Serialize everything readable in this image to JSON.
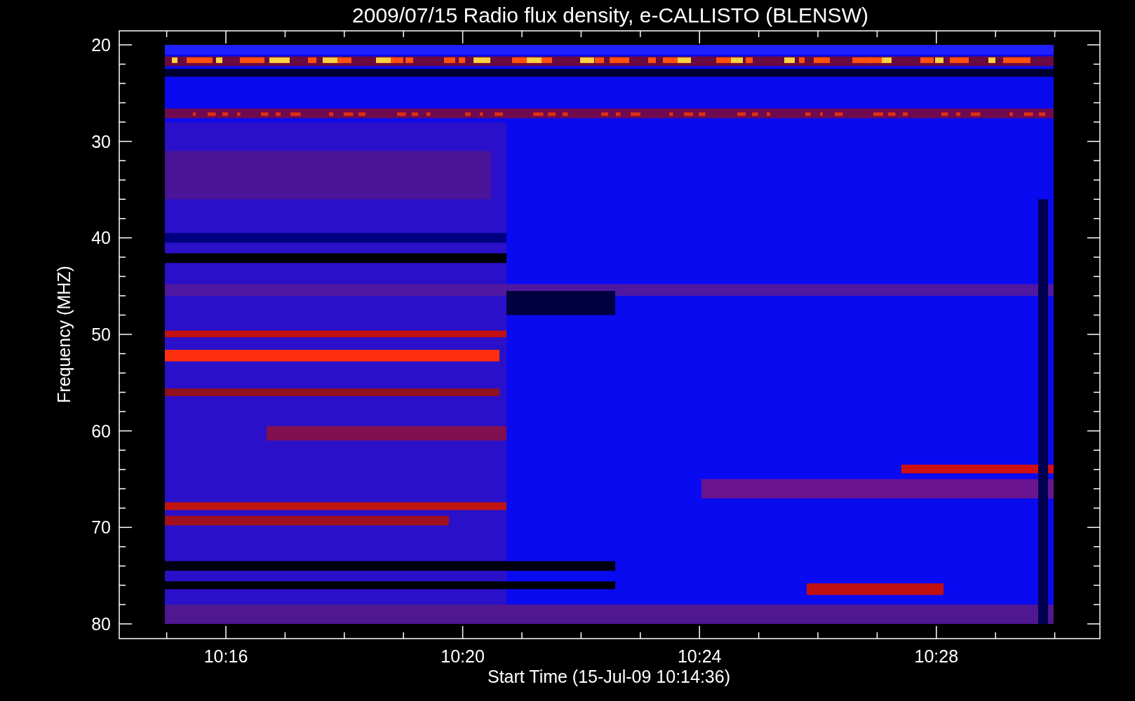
{
  "title": "2009/07/15  Radio flux density, e-CALLISTO (BLENSW)",
  "y_axis": {
    "label": "Frequency (MHZ)",
    "ticks": [
      "20",
      "30",
      "40",
      "50",
      "60",
      "70",
      "80"
    ]
  },
  "x_axis": {
    "label": "Start Time (15-Jul-09 10:14:36)",
    "ticks": [
      "10:16",
      "10:20",
      "10:24",
      "10:28"
    ]
  }
}
